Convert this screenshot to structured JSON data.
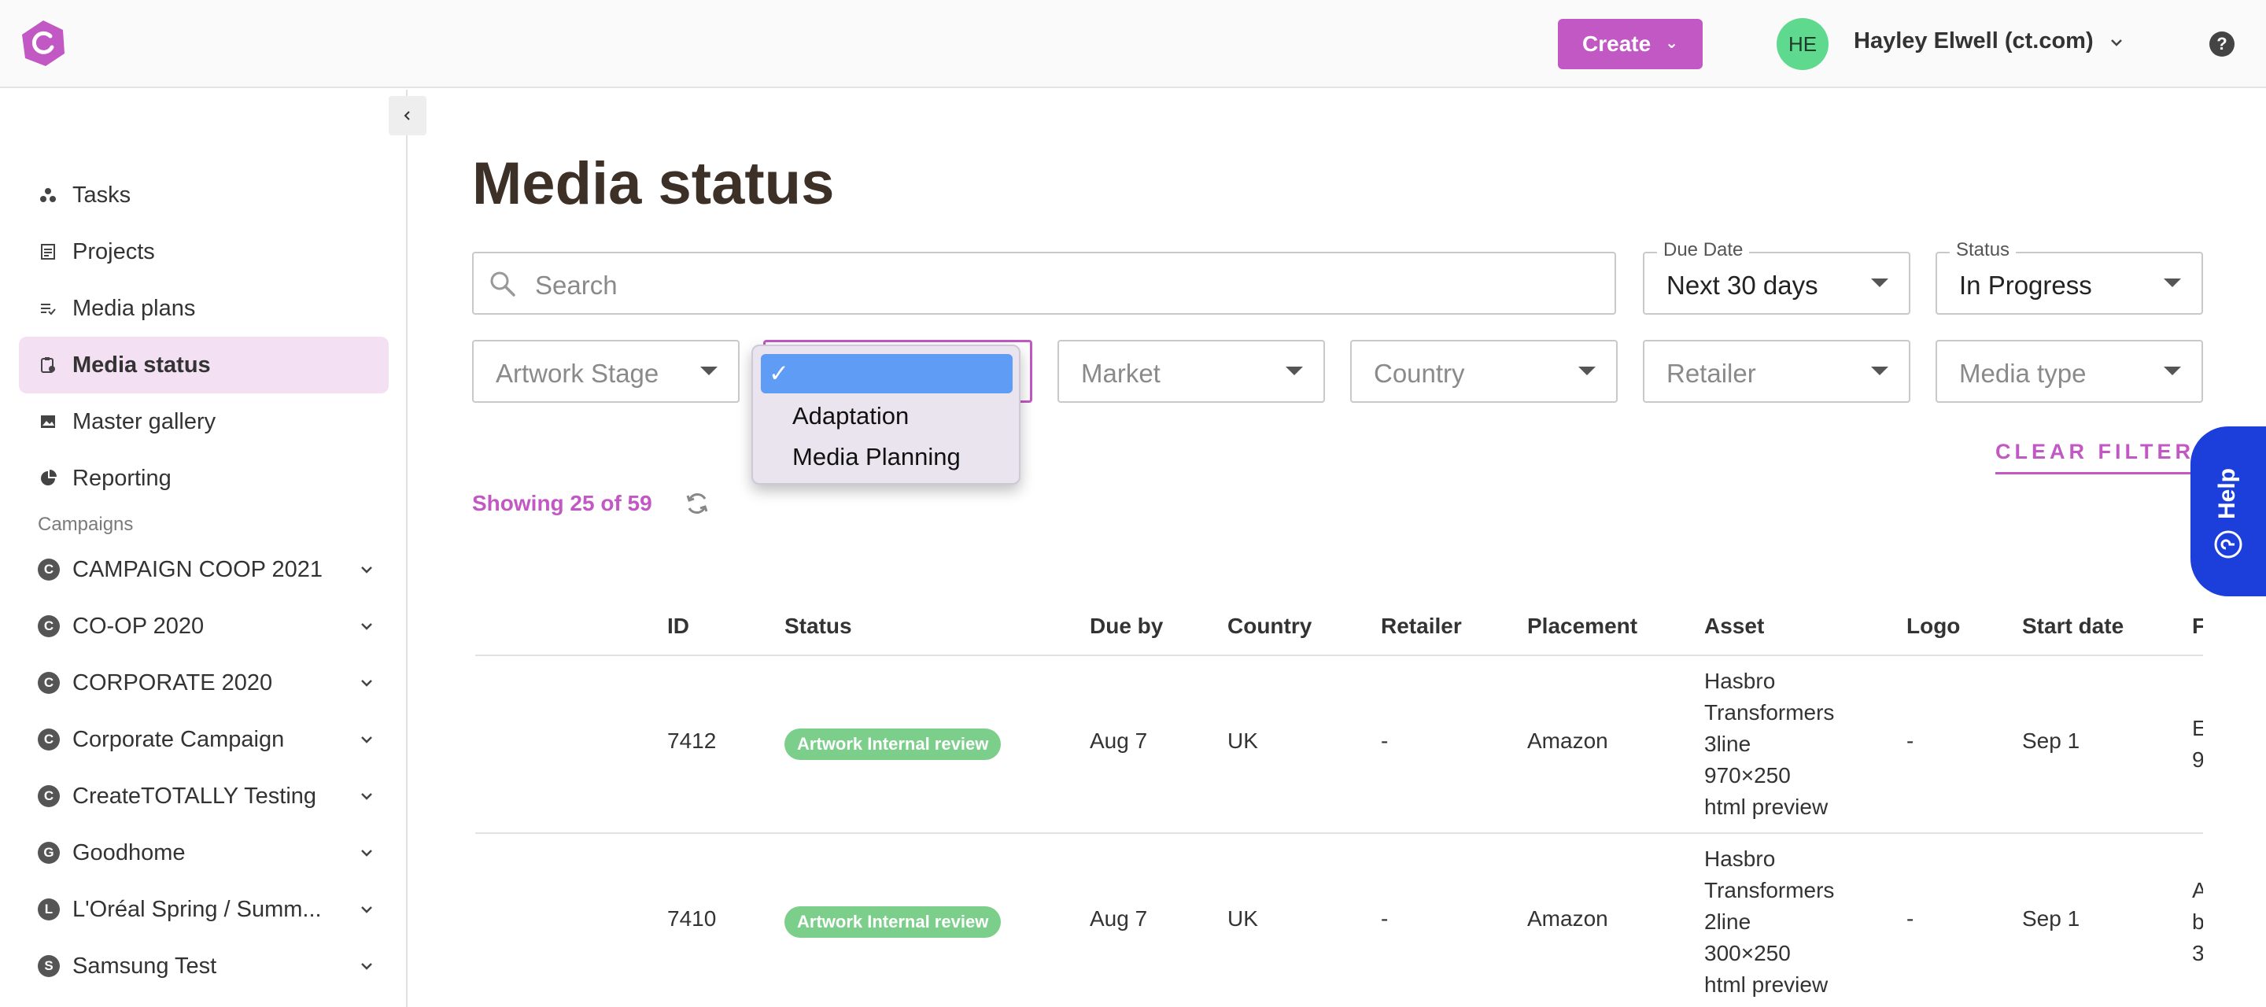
{
  "header": {
    "create_label": "Create",
    "avatar_initials": "HE",
    "user_name": "Hayley Elwell (ct.com)"
  },
  "sidebar": {
    "nav": [
      {
        "label": "Tasks",
        "icon": "tasks-icon"
      },
      {
        "label": "Projects",
        "icon": "projects-icon"
      },
      {
        "label": "Media plans",
        "icon": "media-plans-icon"
      },
      {
        "label": "Media status",
        "icon": "media-status-icon",
        "active": true
      },
      {
        "label": "Master gallery",
        "icon": "gallery-icon"
      },
      {
        "label": "Reporting",
        "icon": "reporting-icon"
      }
    ],
    "campaigns_label": "Campaigns",
    "campaigns": [
      {
        "letter": "C",
        "label": "CAMPAIGN COOP 2021"
      },
      {
        "letter": "C",
        "label": "CO-OP 2020"
      },
      {
        "letter": "C",
        "label": "CORPORATE 2020"
      },
      {
        "letter": "C",
        "label": "Corporate Campaign"
      },
      {
        "letter": "C",
        "label": "CreateTOTALLY Testing"
      },
      {
        "letter": "G",
        "label": "Goodhome"
      },
      {
        "letter": "L",
        "label": "L'Oréal Spring / Summ..."
      },
      {
        "letter": "S",
        "label": "Samsung Test"
      }
    ]
  },
  "main": {
    "title": "Media status",
    "search_placeholder": "Search",
    "due_date": {
      "label": "Due Date",
      "value": "Next 30 days"
    },
    "status": {
      "label": "Status",
      "value": "In Progress"
    },
    "filters": {
      "artwork_stage": "Artwork Stage",
      "market": "Market",
      "country": "Country",
      "retailer": "Retailer",
      "media_type": "Media type"
    },
    "dropdown": {
      "check": "✓",
      "options": [
        "Adaptation",
        "Media Planning"
      ]
    },
    "clear_filters": "CLEAR FILTERS",
    "showing": "Showing 25 of 59",
    "help_label": "Help"
  },
  "table": {
    "columns": [
      "ID",
      "Status",
      "Due by",
      "Country",
      "Retailer",
      "Placement",
      "Asset",
      "Logo",
      "Start date",
      "F"
    ],
    "rows": [
      {
        "id": "7412",
        "status": "Artwork Internal review",
        "due_by": "Aug 7",
        "country": "UK",
        "retailer": "-",
        "placement": "Amazon",
        "asset_lines": [
          "Hasbro",
          "Transformers",
          "3line",
          "970×250",
          "html preview"
        ],
        "logo": "-",
        "start_date": "Sep 1",
        "overflow_lines": [
          "E",
          "9"
        ]
      },
      {
        "id": "7410",
        "status": "Artwork Internal review",
        "due_by": "Aug 7",
        "country": "UK",
        "retailer": "-",
        "placement": "Amazon",
        "asset_lines": [
          "Hasbro",
          "Transformers",
          "2line",
          "300×250",
          "html preview"
        ],
        "logo": "-",
        "start_date": "Sep 1",
        "overflow_lines": [
          "A",
          "b",
          "3"
        ]
      }
    ]
  },
  "colors": {
    "accent": "#c158c4",
    "active_nav_bg": "#f3e0f3",
    "status_badge": "#7ccf8b",
    "help_tab": "#1c3fdc",
    "avatar_bg": "#5ed98d",
    "title_color": "#3d3027"
  }
}
